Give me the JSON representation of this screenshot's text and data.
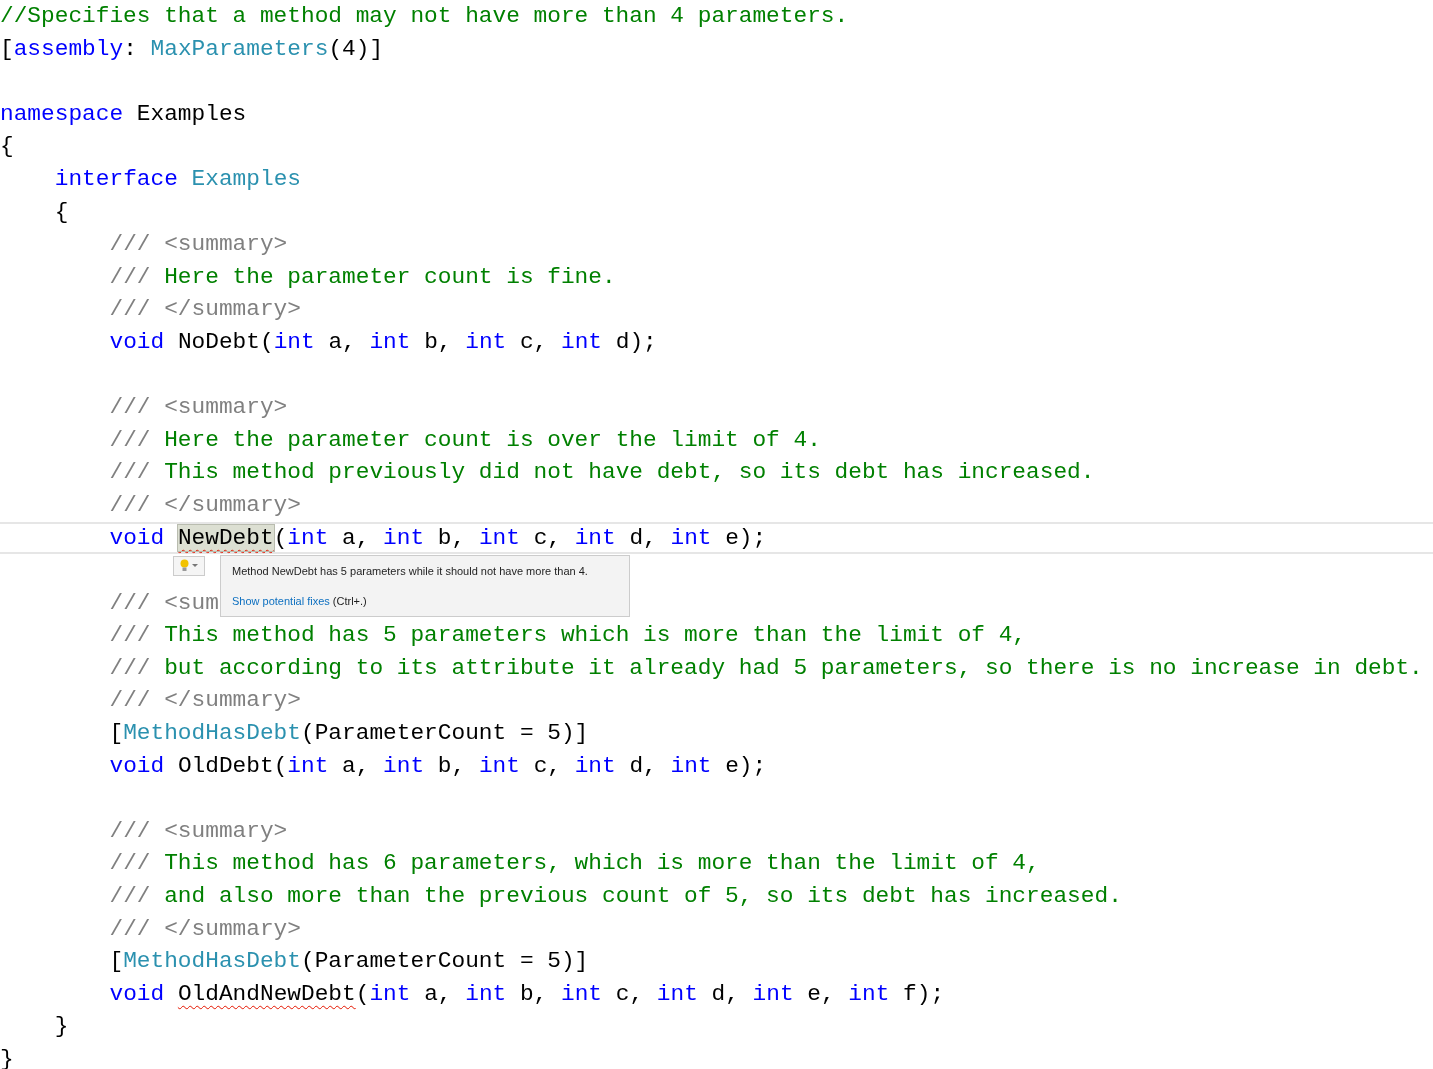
{
  "editor": {
    "blocks": [
      {
        "lines": [
          {
            "tokens": [
              {
                "text": "//Specifies that a method may not have more than 4 parameters.",
                "kind": "comment"
              }
            ]
          },
          {
            "tokens": [
              {
                "text": "[",
                "kind": "plain"
              },
              {
                "text": "assembly",
                "kind": "keyword"
              },
              {
                "text": ": ",
                "kind": "plain"
              },
              {
                "text": "MaxParameters",
                "kind": "type"
              },
              {
                "text": "(4)]",
                "kind": "plain"
              }
            ]
          }
        ]
      },
      {
        "lines": [
          {
            "tokens": [
              {
                "text": "namespace",
                "kind": "keyword"
              },
              {
                "text": " Examples",
                "kind": "plain"
              }
            ]
          },
          {
            "tokens": [
              {
                "text": "{",
                "kind": "plain"
              }
            ]
          },
          {
            "tokens": [
              {
                "text": "    interface",
                "kind": "keyword"
              },
              {
                "text": " Examples",
                "kind": "type"
              }
            ]
          },
          {
            "tokens": [
              {
                "text": "    {",
                "kind": "plain"
              }
            ]
          },
          {
            "tokens": [
              {
                "text": "        /// <summary>",
                "kind": "doc"
              }
            ]
          },
          {
            "tokens": [
              {
                "text": "        ///",
                "kind": "doc"
              },
              {
                "text": " Here the parameter count is fine.",
                "kind": "comment"
              }
            ]
          },
          {
            "tokens": [
              {
                "text": "        /// </summary>",
                "kind": "doc"
              }
            ]
          },
          {
            "tokens": [
              {
                "text": "        void",
                "kind": "keyword"
              },
              {
                "text": " NoDebt(",
                "kind": "plain"
              },
              {
                "text": "int",
                "kind": "keyword"
              },
              {
                "text": " a, ",
                "kind": "plain"
              },
              {
                "text": "int",
                "kind": "keyword"
              },
              {
                "text": " b, ",
                "kind": "plain"
              },
              {
                "text": "int",
                "kind": "keyword"
              },
              {
                "text": " c, ",
                "kind": "plain"
              },
              {
                "text": "int",
                "kind": "keyword"
              },
              {
                "text": " d);",
                "kind": "plain"
              }
            ]
          }
        ]
      },
      {
        "lines": [
          {
            "tokens": [
              {
                "text": "        /// <summary>",
                "kind": "doc"
              }
            ]
          },
          {
            "tokens": [
              {
                "text": "        ///",
                "kind": "doc"
              },
              {
                "text": " Here the parameter count is over the limit of 4.",
                "kind": "comment"
              }
            ]
          },
          {
            "tokens": [
              {
                "text": "        ///",
                "kind": "doc"
              },
              {
                "text": " This method previously did not have debt, so its debt has increased.",
                "kind": "comment"
              }
            ]
          },
          {
            "tokens": [
              {
                "text": "        /// </summary>",
                "kind": "doc"
              }
            ]
          },
          {
            "current": true,
            "tokens": [
              {
                "text": "        void",
                "kind": "keyword"
              },
              {
                "text": " NewDebt",
                "kind": "plain",
                "squiggle": true,
                "highlight": true
              },
              {
                "text": "(",
                "kind": "plain"
              },
              {
                "text": "int",
                "kind": "keyword"
              },
              {
                "text": " a, ",
                "kind": "plain"
              },
              {
                "text": "int",
                "kind": "keyword"
              },
              {
                "text": " b, ",
                "kind": "plain"
              },
              {
                "text": "int",
                "kind": "keyword"
              },
              {
                "text": " c, ",
                "kind": "plain"
              },
              {
                "text": "int",
                "kind": "keyword"
              },
              {
                "text": " d, ",
                "kind": "plain"
              },
              {
                "text": "int",
                "kind": "keyword"
              },
              {
                "text": " e);",
                "kind": "plain"
              }
            ],
            "tooltip": {
              "message": "Method NewDebt has 5 parameters while it should not have more than 4.",
              "link": "Show potential fixes",
              "shortcut": "(Ctrl+.)"
            }
          }
        ]
      },
      {
        "lines": [
          {
            "tokens": [
              {
                "text": "        /// <sum",
                "kind": "doc"
              }
            ]
          },
          {
            "tokens": [
              {
                "text": "        ///",
                "kind": "doc"
              },
              {
                "text": " This method has 5 parameters which is more than the limit of 4,",
                "kind": "comment"
              }
            ]
          },
          {
            "tokens": [
              {
                "text": "        ///",
                "kind": "doc"
              },
              {
                "text": " but according to its attribute it already had 5 parameters, so there is no increase in debt.",
                "kind": "comment"
              }
            ]
          },
          {
            "tokens": [
              {
                "text": "        /// </summary>",
                "kind": "doc"
              }
            ]
          },
          {
            "tokens": [
              {
                "text": "        [",
                "kind": "plain"
              },
              {
                "text": "MethodHasDebt",
                "kind": "type"
              },
              {
                "text": "(ParameterCount = 5)]",
                "kind": "plain"
              }
            ]
          },
          {
            "tokens": [
              {
                "text": "        void",
                "kind": "keyword"
              },
              {
                "text": " OldDebt(",
                "kind": "plain"
              },
              {
                "text": "int",
                "kind": "keyword"
              },
              {
                "text": " a, ",
                "kind": "plain"
              },
              {
                "text": "int",
                "kind": "keyword"
              },
              {
                "text": " b, ",
                "kind": "plain"
              },
              {
                "text": "int",
                "kind": "keyword"
              },
              {
                "text": " c, ",
                "kind": "plain"
              },
              {
                "text": "int",
                "kind": "keyword"
              },
              {
                "text": " d, ",
                "kind": "plain"
              },
              {
                "text": "int",
                "kind": "keyword"
              },
              {
                "text": " e);",
                "kind": "plain"
              }
            ]
          }
        ]
      },
      {
        "lines": [
          {
            "tokens": [
              {
                "text": "        /// <summary>",
                "kind": "doc"
              }
            ]
          },
          {
            "tokens": [
              {
                "text": "        ///",
                "kind": "doc"
              },
              {
                "text": " This method has 6 parameters, which is more than the limit of 4,",
                "kind": "comment"
              }
            ]
          },
          {
            "tokens": [
              {
                "text": "        ///",
                "kind": "doc"
              },
              {
                "text": " and also more than the previous count of 5, so its debt has increased.",
                "kind": "comment"
              }
            ]
          },
          {
            "tokens": [
              {
                "text": "        /// </summary>",
                "kind": "doc"
              }
            ]
          },
          {
            "tokens": [
              {
                "text": "        [",
                "kind": "plain"
              },
              {
                "text": "MethodHasDebt",
                "kind": "type"
              },
              {
                "text": "(ParameterCount = 5)]",
                "kind": "plain"
              }
            ]
          },
          {
            "tokens": [
              {
                "text": "        void",
                "kind": "keyword"
              },
              {
                "text": " OldAndNewDebt",
                "kind": "plain",
                "squiggle": true
              },
              {
                "text": "(",
                "kind": "plain"
              },
              {
                "text": "int",
                "kind": "keyword"
              },
              {
                "text": " a, ",
                "kind": "plain"
              },
              {
                "text": "int",
                "kind": "keyword"
              },
              {
                "text": " b, ",
                "kind": "plain"
              },
              {
                "text": "int",
                "kind": "keyword"
              },
              {
                "text": " c, ",
                "kind": "plain"
              },
              {
                "text": "int",
                "kind": "keyword"
              },
              {
                "text": " d, ",
                "kind": "plain"
              },
              {
                "text": "int",
                "kind": "keyword"
              },
              {
                "text": " e, ",
                "kind": "plain"
              },
              {
                "text": "int",
                "kind": "keyword"
              },
              {
                "text": " f);",
                "kind": "plain"
              }
            ]
          },
          {
            "tokens": [
              {
                "text": "    }",
                "kind": "plain"
              }
            ]
          },
          {
            "tokens": [
              {
                "text": "}",
                "kind": "plain"
              }
            ]
          }
        ]
      }
    ]
  }
}
